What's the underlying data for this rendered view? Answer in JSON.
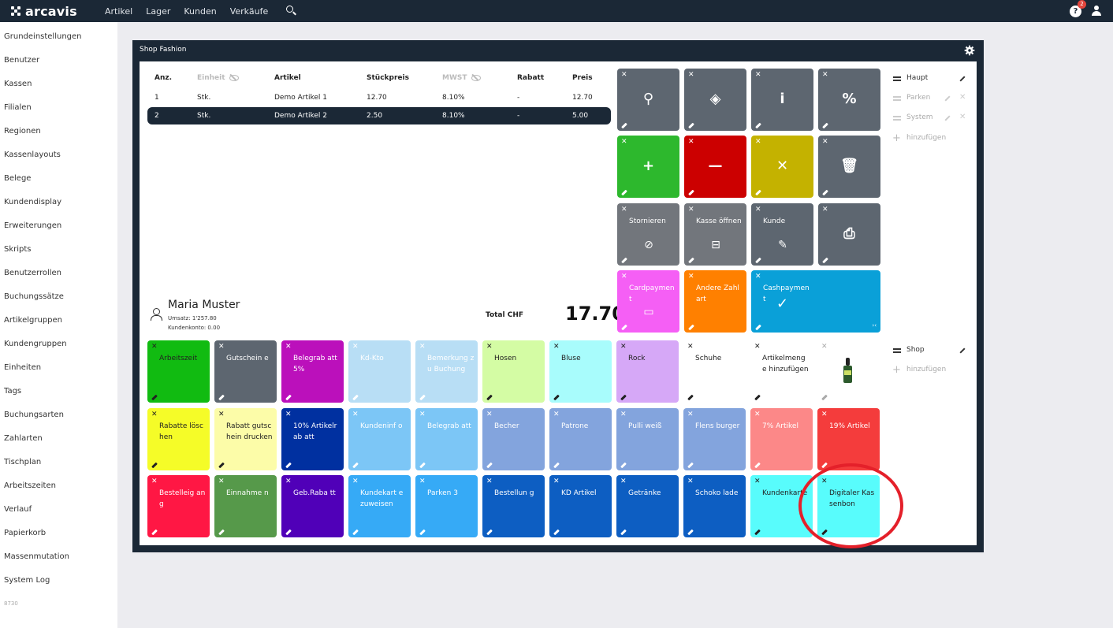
{
  "app": {
    "logo_text": "arcavis"
  },
  "nav": {
    "items": [
      "Artikel",
      "Lager",
      "Kunden",
      "Verkäufe"
    ],
    "help_badge": "2"
  },
  "sidebar": {
    "items": [
      "Grundeinstellungen",
      "Benutzer",
      "Kassen",
      "Filialen",
      "Regionen",
      "Kassenlayouts",
      "Belege",
      "Kundendisplay",
      "Erweiterungen",
      "Skripts",
      "Benutzerrollen",
      "Buchungssätze",
      "Artikelgruppen",
      "Kundengruppen",
      "Einheiten",
      "Tags",
      "Buchungsarten",
      "Zahlarten",
      "Tischplan",
      "Arbeitszeiten",
      "Verlauf",
      "Papierkorb",
      "Massenmutation",
      "System Log"
    ],
    "version": "8730"
  },
  "panel": {
    "title": "Shop Fashion"
  },
  "table": {
    "headers": [
      "Anz.",
      "Einheit",
      "Artikel",
      "Stückpreis",
      "MWST",
      "Rabatt",
      "Preis"
    ],
    "rows": [
      [
        "1",
        "Stk.",
        "Demo Artikel 1",
        "12.70",
        "8.10%",
        "-",
        "12.70"
      ],
      [
        "2",
        "Stk.",
        "Demo Artikel 2",
        "2.50",
        "8.10%",
        "-",
        "5.00"
      ]
    ]
  },
  "customer": {
    "name": "Maria Muster",
    "umsatz": "Umsatz: 1'257.80",
    "konto": "Kundenkonto: 0.00"
  },
  "total": {
    "label": "Total CHF",
    "value": "17.70"
  },
  "func_tiles": [
    {
      "label": "",
      "icon": "search-icon",
      "glyph": "⚲",
      "color": "#5d6670",
      "text": "#ffffff"
    },
    {
      "label": "",
      "icon": "layers-icon",
      "glyph": "◈",
      "color": "#5d6670",
      "text": "#ffffff"
    },
    {
      "label": "",
      "icon": "info-icon",
      "glyph": "i",
      "color": "#5d6670",
      "text": "#ffffff"
    },
    {
      "label": "",
      "icon": "percent-icon",
      "glyph": "%",
      "color": "#5d6670",
      "text": "#ffffff"
    },
    {
      "label": "",
      "icon": "plus-icon",
      "glyph": "+",
      "color": "#2db82d",
      "text": "#ffffff"
    },
    {
      "label": "",
      "icon": "minus-icon",
      "glyph": "—",
      "color": "#cc0000",
      "text": "#ffffff"
    },
    {
      "label": "",
      "icon": "times-icon",
      "glyph": "✕",
      "color": "#c4b200",
      "text": "#ffffff"
    },
    {
      "label": "",
      "icon": "trash-icon",
      "glyph": "🗑",
      "color": "#5d6670",
      "text": "#ffffff"
    },
    {
      "label": "Stornieren",
      "icon": "cancel-icon",
      "glyph": "⊘",
      "color": "#72767c",
      "text": "#ffffff"
    },
    {
      "label": "Kasse öffnen",
      "icon": "cash-drawer-icon",
      "glyph": "⊟",
      "color": "#72767c",
      "text": "#ffffff"
    },
    {
      "label": "Kunde",
      "icon": "customer-icon",
      "glyph": "✎",
      "color": "#5d6670",
      "text": "#ffffff"
    },
    {
      "label": "",
      "icon": "printer-icon",
      "glyph": "⎙",
      "color": "#5d6670",
      "text": "#ffffff"
    },
    {
      "label": "Cardpayment",
      "icon": "card-icon",
      "glyph": "▭",
      "color": "#f55ff5",
      "text": "#ffffff"
    },
    {
      "label": "Andere Zahlart",
      "icon": "",
      "glyph": "",
      "color": "#ff8000",
      "text": "#ffffff"
    }
  ],
  "cashpayment": {
    "label": "Cashpayment",
    "icon": "check-icon",
    "glyph": "✓",
    "color": "#0aa0d8",
    "corner": "›‹"
  },
  "article_tiles": [
    {
      "label": "Arbeitszeit",
      "color": "#11bb11",
      "text": "#222222"
    },
    {
      "label": "Gutschein e",
      "color": "#5d6670",
      "text": "#ffffff"
    },
    {
      "label": "Belegrab att 5%",
      "color": "#bb10bb",
      "text": "#ffffff"
    },
    {
      "label": "Kd-Kto",
      "color": "#b8def5",
      "text": "#ffffff"
    },
    {
      "label": "Bemerkung zu Buchung",
      "color": "#b8def5",
      "text": "#ffffff"
    },
    {
      "label": "Hosen",
      "color": "#d4fca4",
      "text": "#222222"
    },
    {
      "label": "Bluse",
      "color": "#a8fcfc",
      "text": "#222222"
    },
    {
      "label": "Rock",
      "color": "#d6a8f7",
      "text": "#222222"
    },
    {
      "label": "Schuhe",
      "color": "#ffffff",
      "text": "#222222"
    },
    {
      "label": "Artikelmenge hinzufügen",
      "color": "#ffffff",
      "text": "#222222"
    },
    {
      "label": "",
      "color": "#ffffff",
      "text": "#aaaaaa",
      "image": "bottle-product-image"
    },
    {
      "label": "Rabatte löschen",
      "color": "#f5fc28",
      "text": "#222222"
    },
    {
      "label": "Rabatt gutschein drucken",
      "color": "#fcfca8",
      "text": "#222222"
    },
    {
      "label": "10% Artikelrab att",
      "color": "#0030a0",
      "text": "#ffffff"
    },
    {
      "label": "Kundeninf o",
      "color": "#7cc6f6",
      "text": "#ffffff"
    },
    {
      "label": "Belegrab att",
      "color": "#7cc6f6",
      "text": "#ffffff"
    },
    {
      "label": "Becher",
      "color": "#83a4dd",
      "text": "#ffffff"
    },
    {
      "label": "Patrone",
      "color": "#83a4dd",
      "text": "#ffffff"
    },
    {
      "label": "Pulli weiß",
      "color": "#83a4dd",
      "text": "#ffffff"
    },
    {
      "label": "Flens burger",
      "color": "#83a4dd",
      "text": "#ffffff"
    },
    {
      "label": "7% Artikel",
      "color": "#fc8888",
      "text": "#ffffff"
    },
    {
      "label": "19% Artikel",
      "color": "#f43c3c",
      "text": "#ffffff"
    },
    {
      "label": "Bestelleig ang",
      "color": "#ff1744",
      "text": "#ffffff"
    },
    {
      "label": "Einnahme n",
      "color": "#56994a",
      "text": "#ffffff"
    },
    {
      "label": "Geb.Raba tt",
      "color": "#5000b8",
      "text": "#ffffff"
    },
    {
      "label": "Kundekart e zuweisen",
      "color": "#36aaf6",
      "text": "#ffffff"
    },
    {
      "label": "Parken 3",
      "color": "#36aaf6",
      "text": "#ffffff"
    },
    {
      "label": "Bestellun g",
      "color": "#0d5ec2",
      "text": "#ffffff"
    },
    {
      "label": "KD Artikel",
      "color": "#0d5ec2",
      "text": "#ffffff"
    },
    {
      "label": "Getränke",
      "color": "#0d5ec2",
      "text": "#ffffff"
    },
    {
      "label": "Schoko lade",
      "color": "#0d5ec2",
      "text": "#ffffff"
    },
    {
      "label": "Kundenkarte",
      "color": "#58fcfc",
      "text": "#222222"
    },
    {
      "label": "Digitaler Kassenbon",
      "color": "#58fcfc",
      "text": "#222222"
    }
  ],
  "right_top": [
    {
      "label": "Haupt",
      "active": true
    },
    {
      "label": "Parken",
      "active": false
    },
    {
      "label": "System",
      "active": false
    }
  ],
  "right_bottom": [
    {
      "label": "Shop",
      "active": true
    }
  ],
  "add_label": "hinzufügen"
}
